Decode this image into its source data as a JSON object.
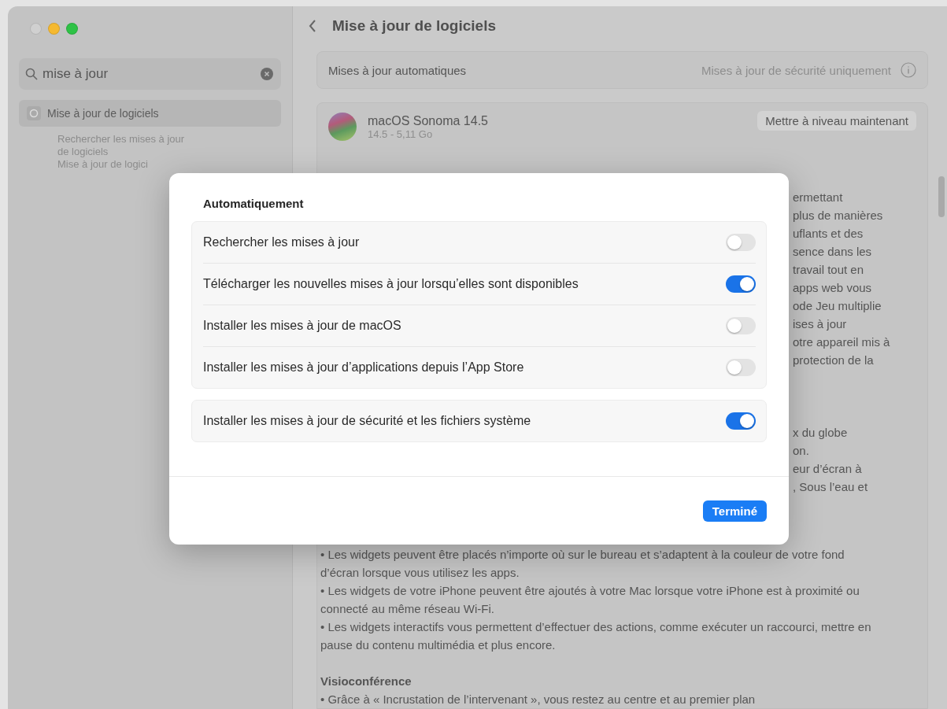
{
  "sidebar": {
    "search": {
      "value": "mise à jour"
    },
    "results": [
      {
        "label": "Mise à jour de logiciels",
        "selected": true,
        "children": [
          {
            "label": "Rechercher les mises à jour de logiciels"
          },
          {
            "label": "Mise à jour de logici"
          }
        ]
      }
    ]
  },
  "header": {
    "title": "Mise à jour de logiciels"
  },
  "auto_updates": {
    "label": "Mises à jour automatiques",
    "value": "Mises à jour de sécurité uniquement"
  },
  "update": {
    "name": "macOS Sonoma 14.5",
    "detail": "14.5 - 5,11 Go",
    "button": "Mettre à niveau maintenant"
  },
  "release_notes": {
    "fragments_top": [
      "ermettant",
      "plus de manières",
      "uflants et des",
      "sence dans les",
      "travail tout en",
      "apps web vous",
      "ode Jeu multiplie",
      "ises à jour",
      "otre appareil mis à",
      "protection de la"
    ],
    "fragments_middle": [
      "x du globe",
      "on.",
      "eur d’écran à",
      ", Sous l’eau et"
    ],
    "bullets": [
      "• Les widgets peuvent être placés n’importe où sur le bureau et s’adaptent à la couleur de votre fond d’écran lorsque vous utilisez les apps.",
      "• Les widgets de votre iPhone peuvent être ajoutés à votre Mac lorsque votre iPhone est à proximité ou connecté au même réseau Wi-Fi.",
      "• Les widgets interactifs vous permettent d’effectuer des actions, comme exécuter un raccourci, mettre en pause du contenu multimédia et plus encore."
    ],
    "heading": "Visioconférence",
    "last_line": "• Grâce à « Incrustation de l’intervenant », vous restez au centre et au premier plan"
  },
  "dialog": {
    "title": "Automatiquement",
    "groups": [
      [
        {
          "label": "Rechercher les mises à jour",
          "on": false
        },
        {
          "label": "Télécharger les nouvelles mises à jour lorsqu’elles sont disponibles",
          "on": true
        },
        {
          "label": "Installer les mises à jour de macOS",
          "on": false
        },
        {
          "label": "Installer les mises à jour d’applications depuis l’App Store",
          "on": false
        }
      ],
      [
        {
          "label": "Installer les mises à jour de sécurité et les fichiers système",
          "on": true
        }
      ]
    ],
    "button": "Terminé"
  }
}
